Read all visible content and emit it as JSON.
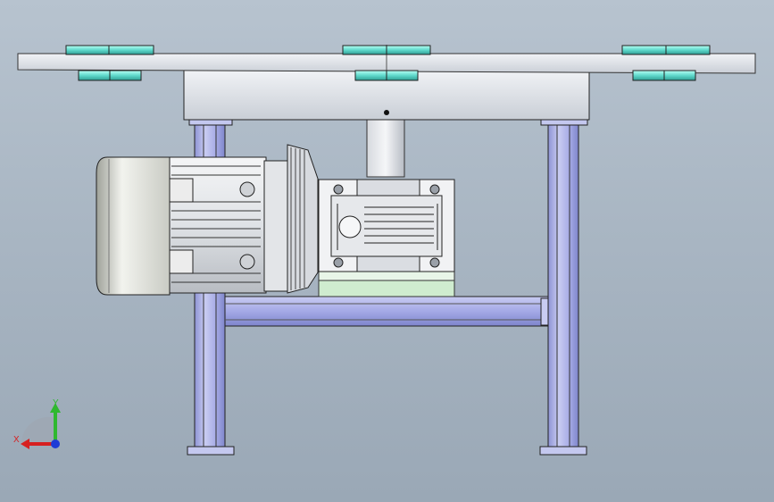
{
  "viewport": {
    "background_top": "#b7c3cf",
    "background_bottom": "#9aa8b6"
  },
  "triad": {
    "x_label": "X",
    "y_label": "Y",
    "x_color": "#d62020",
    "y_color": "#2fb82f",
    "z_color": "#1e3cd6"
  },
  "model": {
    "frame_color": "#a9aee6",
    "plate_color": "#dfe4ea",
    "bearing_color": "#7fe6d8",
    "motor_color": "#e7e9ec",
    "gearbox_mount_color": "#cfeccf"
  }
}
